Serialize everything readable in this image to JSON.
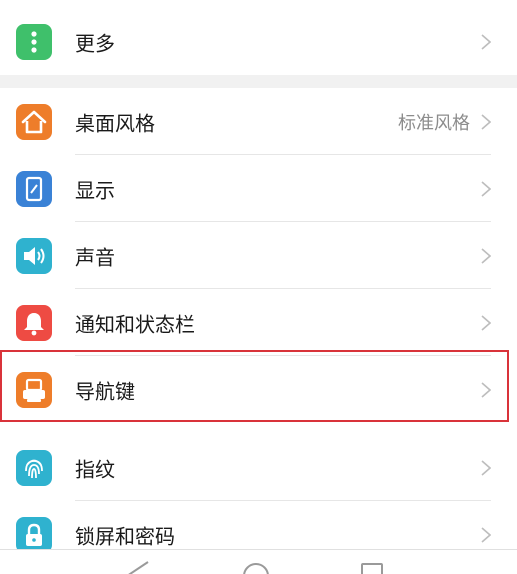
{
  "colors": {
    "more": "#3fc06b",
    "desktop_style": "#ee7d2a",
    "display": "#3a82d6",
    "sound": "#2fb2cf",
    "notifications": "#ee4b43",
    "nav_keys": "#ee7d2a",
    "fingerprint": "#2fb2cf",
    "lock_screen": "#2fb2cf",
    "highlight_box": "#d9333a"
  },
  "rows": {
    "more": {
      "label": "更多",
      "icon": "more-dots-icon"
    },
    "desktop_style": {
      "label": "桌面风格",
      "value": "标准风格",
      "icon": "home-icon"
    },
    "display": {
      "label": "显示",
      "icon": "display-icon"
    },
    "sound": {
      "label": "声音",
      "icon": "speaker-icon"
    },
    "notifications": {
      "label": "通知和状态栏",
      "icon": "bell-icon"
    },
    "nav_keys": {
      "label": "导航键",
      "icon": "nav-key-icon"
    },
    "fingerprint": {
      "label": "指纹",
      "icon": "fingerprint-icon"
    },
    "lock_screen": {
      "label": "锁屏和密码",
      "icon": "lock-icon"
    }
  },
  "navbar": {
    "buttons": [
      "back-icon",
      "home-circle-icon",
      "recents-square-icon"
    ]
  }
}
